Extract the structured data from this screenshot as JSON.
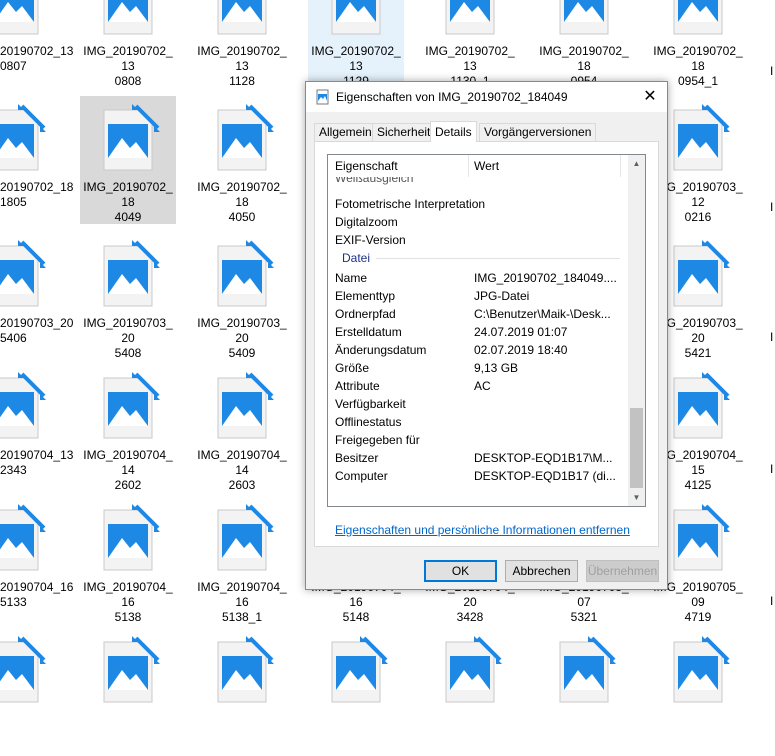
{
  "explorer": {
    "tiles": [
      {
        "line1": "20190702_13",
        "line2": "0807",
        "state": "normal"
      },
      {
        "line1": "IMG_20190702_13",
        "line2": "0808",
        "state": "normal"
      },
      {
        "line1": "IMG_20190702_13",
        "line2": "1128",
        "state": "normal"
      },
      {
        "line1": "IMG_20190702_13",
        "line2": "1129",
        "state": "hover"
      },
      {
        "line1": "IMG_20190702_13",
        "line2": "1130_1",
        "state": "normal"
      },
      {
        "line1": "IMG_20190702_18",
        "line2": "0954",
        "state": "normal"
      },
      {
        "line1": "IMG_20190702_18",
        "line2": "0954_1",
        "state": "normal"
      },
      {
        "line1": "20190702_18",
        "line2": "1805",
        "state": "normal"
      },
      {
        "line1": "IMG_20190702_18",
        "line2": "4049",
        "state": "selected"
      },
      {
        "line1": "IMG_20190702_18",
        "line2": "4050",
        "state": "normal"
      },
      {
        "line1": "",
        "line2": "",
        "state": "normal"
      },
      {
        "line1": "",
        "line2": "",
        "state": "normal"
      },
      {
        "line1": "",
        "line2": "",
        "state": "normal"
      },
      {
        "line1": "IMG_20190703_12",
        "line2": "0216",
        "state": "normal"
      },
      {
        "line1": "20190703_20",
        "line2": "5406",
        "state": "normal"
      },
      {
        "line1": "IMG_20190703_20",
        "line2": "5408",
        "state": "normal"
      },
      {
        "line1": "IMG_20190703_20",
        "line2": "5409",
        "state": "normal"
      },
      {
        "line1": "",
        "line2": "",
        "state": "normal"
      },
      {
        "line1": "",
        "line2": "",
        "state": "normal"
      },
      {
        "line1": "",
        "line2": "",
        "state": "normal"
      },
      {
        "line1": "IMG_20190703_20",
        "line2": "5421",
        "state": "normal"
      },
      {
        "line1": "20190704_13",
        "line2": "2343",
        "state": "normal"
      },
      {
        "line1": "IMG_20190704_14",
        "line2": "2602",
        "state": "normal"
      },
      {
        "line1": "IMG_20190704_14",
        "line2": "2603",
        "state": "normal"
      },
      {
        "line1": "",
        "line2": "",
        "state": "normal"
      },
      {
        "line1": "",
        "line2": "",
        "state": "normal"
      },
      {
        "line1": "",
        "line2": "",
        "state": "normal"
      },
      {
        "line1": "IMG_20190704_15",
        "line2": "4125",
        "state": "normal"
      },
      {
        "line1": "20190704_16",
        "line2": "5133",
        "state": "normal"
      },
      {
        "line1": "IMG_20190704_16",
        "line2": "5138",
        "state": "normal"
      },
      {
        "line1": "IMG_20190704_16",
        "line2": "5138_1",
        "state": "normal"
      },
      {
        "line1": "IMG_20190704_16",
        "line2": "5148",
        "state": "normal"
      },
      {
        "line1": "IMG_20190704_20",
        "line2": "3428",
        "state": "normal"
      },
      {
        "line1": "IMG_20190705_07",
        "line2": "5321",
        "state": "normal"
      },
      {
        "line1": "IMG_20190705_09",
        "line2": "4719",
        "state": "normal"
      }
    ],
    "edge_glyph": "I",
    "colors": {
      "icon_blue": "#1e88e5",
      "page": "#f3f3f3",
      "selected": "#d9d9d9",
      "hover": "#e5f1fb"
    }
  },
  "dialog": {
    "title": "Eigenschaften von IMG_20190702_184049",
    "close_glyph": "✕",
    "tabs": [
      "Allgemein",
      "Sicherheit",
      "Details",
      "Vorgängerversionen"
    ],
    "active_tab": "Details",
    "list": {
      "header": {
        "property": "Eigenschaft",
        "value": "Wert"
      },
      "partial_row": "Weißausgleich",
      "camera_rows": [
        {
          "k": "Fotometrische Interpretation",
          "v": ""
        },
        {
          "k": "Digitalzoom",
          "v": ""
        },
        {
          "k": "EXIF-Version",
          "v": ""
        }
      ],
      "file_group": "Datei",
      "file_rows": [
        {
          "k": "Name",
          "v": "IMG_20190702_184049...."
        },
        {
          "k": "Elementtyp",
          "v": "JPG-Datei"
        },
        {
          "k": "Ordnerpfad",
          "v": "C:\\Benutzer\\Maik-\\Desk..."
        },
        {
          "k": "Erstelldatum",
          "v": "24.07.2019 01:07"
        },
        {
          "k": "Änderungsdatum",
          "v": "02.07.2019 18:40"
        },
        {
          "k": "Größe",
          "v": "9,13 GB"
        },
        {
          "k": "Attribute",
          "v": "AC"
        },
        {
          "k": "Verfügbarkeit",
          "v": ""
        },
        {
          "k": "Offlinestatus",
          "v": ""
        },
        {
          "k": "Freigegeben für",
          "v": ""
        },
        {
          "k": "Besitzer",
          "v": "DESKTOP-EQD1B17\\M..."
        },
        {
          "k": "Computer",
          "v": "DESKTOP-EQD1B17 (di..."
        }
      ]
    },
    "remove_link": "Eigenschaften und persönliche Informationen entfernen",
    "buttons": {
      "ok": "OK",
      "cancel": "Abbrechen",
      "apply": "Übernehmen"
    }
  }
}
